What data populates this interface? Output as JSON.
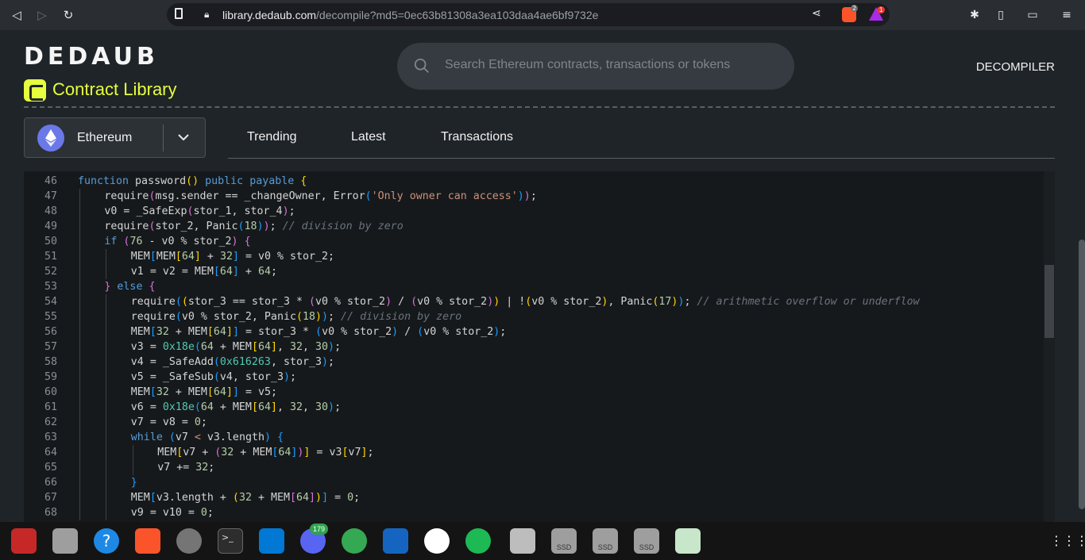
{
  "browser": {
    "url_host": "library.dedaub.com",
    "url_path": "/decompile?md5=0ec63b81308a3ea103daa4ae6bf9732e",
    "brave_badge": "2",
    "alert_badge": "1"
  },
  "header": {
    "logo": "DEDAUB",
    "library_title": "Contract Library",
    "search_placeholder": "Search Ethereum contracts, transactions or tokens",
    "nav_decompiler": "DECOMPILER"
  },
  "chain_select": {
    "selected": "Ethereum"
  },
  "tabs": [
    {
      "label": "Trending"
    },
    {
      "label": "Latest"
    },
    {
      "label": "Transactions"
    }
  ],
  "code": {
    "lines": [
      {
        "no": "46",
        "indent": 0,
        "html": "<span class=\"k\">function</span> password<span class=\"p1\">()</span> <span class=\"k\">public</span> <span class=\"k\">payable</span> <span class=\"p1\">{</span>"
      },
      {
        "no": "47",
        "indent": 1,
        "html": "require<span class=\"p2\">(</span>msg.sender == _changeOwner, Error<span class=\"p3\">(</span><span class=\"s\">'Only owner can access'</span><span class=\"p3\">)</span><span class=\"p2\">)</span>;"
      },
      {
        "no": "48",
        "indent": 1,
        "html": "v0 = _SafeExp<span class=\"p2\">(</span>stor_1, stor_4<span class=\"p2\">)</span>;"
      },
      {
        "no": "49",
        "indent": 1,
        "html": "require<span class=\"p2\">(</span>stor_2, Panic<span class=\"p3\">(</span><span class=\"n\">18</span><span class=\"p3\">)</span><span class=\"p2\">)</span>; <span class=\"c\">// division by zero</span>"
      },
      {
        "no": "50",
        "indent": 1,
        "html": "<span class=\"k\">if</span> <span class=\"p2\">(</span><span class=\"n\">76</span> - v0 % stor_2<span class=\"p2\">)</span> <span class=\"p2\">{</span>"
      },
      {
        "no": "51",
        "indent": 2,
        "html": "MEM<span class=\"p3\">[</span>MEM<span class=\"p1\">[</span><span class=\"n\">64</span><span class=\"p1\">]</span> + <span class=\"n\">32</span><span class=\"p3\">]</span> = v0 % stor_2;"
      },
      {
        "no": "52",
        "indent": 2,
        "html": "v1 = v2 = MEM<span class=\"p3\">[</span><span class=\"n\">64</span><span class=\"p3\">]</span> + <span class=\"n\">64</span>;"
      },
      {
        "no": "53",
        "indent": 1,
        "html": "<span class=\"p2\">}</span> <span class=\"k\">else</span> <span class=\"p2\">{</span>"
      },
      {
        "no": "54",
        "indent": 2,
        "html": "require<span class=\"p3\">(</span><span class=\"p1\">(</span>stor_3 == stor_3 * <span class=\"p2\">(</span>v0 % stor_2<span class=\"p2\">)</span> / <span class=\"p2\">(</span>v0 % stor_2<span class=\"p2\">)</span><span class=\"p1\">)</span> | !<span class=\"p1\">(</span>v0 % stor_2<span class=\"p1\">)</span>, Panic<span class=\"p1\">(</span><span class=\"n\">17</span><span class=\"p1\">)</span><span class=\"p3\">)</span>; <span class=\"c\">// arithmetic overflow or underflow</span>"
      },
      {
        "no": "55",
        "indent": 2,
        "html": "require<span class=\"p3\">(</span>v0 % stor_2, Panic<span class=\"p1\">(</span><span class=\"n\">18</span><span class=\"p1\">)</span><span class=\"p3\">)</span>; <span class=\"c\">// division by zero</span>"
      },
      {
        "no": "56",
        "indent": 2,
        "html": "MEM<span class=\"p3\">[</span><span class=\"n\">32</span> + MEM<span class=\"p1\">[</span><span class=\"n\">64</span><span class=\"p1\">]</span><span class=\"p3\">]</span> = stor_3 * <span class=\"p3\">(</span>v0 % stor_2<span class=\"p3\">)</span> / <span class=\"p3\">(</span>v0 % stor_2<span class=\"p3\">)</span>;"
      },
      {
        "no": "57",
        "indent": 2,
        "html": "v3 = <span class=\"h\">0x18e</span><span class=\"p3\">(</span><span class=\"n\">64</span> + MEM<span class=\"p1\">[</span><span class=\"n\">64</span><span class=\"p1\">]</span>, <span class=\"n\">32</span>, <span class=\"n\">30</span><span class=\"p3\">)</span>;"
      },
      {
        "no": "58",
        "indent": 2,
        "html": "v4 = _SafeAdd<span class=\"p3\">(</span><span class=\"h\">0x616263</span>, stor_3<span class=\"p3\">)</span>;"
      },
      {
        "no": "59",
        "indent": 2,
        "html": "v5 = _SafeSub<span class=\"p3\">(</span>v4, stor_3<span class=\"p3\">)</span>;"
      },
      {
        "no": "60",
        "indent": 2,
        "html": "MEM<span class=\"p3\">[</span><span class=\"n\">32</span> + MEM<span class=\"p1\">[</span><span class=\"n\">64</span><span class=\"p1\">]</span><span class=\"p3\">]</span> = v5;"
      },
      {
        "no": "61",
        "indent": 2,
        "html": "v6 = <span class=\"h\">0x18e</span><span class=\"p3\">(</span><span class=\"n\">64</span> + MEM<span class=\"p1\">[</span><span class=\"n\">64</span><span class=\"p1\">]</span>, <span class=\"n\">32</span>, <span class=\"n\">30</span><span class=\"p3\">)</span>;"
      },
      {
        "no": "62",
        "indent": 2,
        "html": "v7 = v8 = <span class=\"n\">0</span>;"
      },
      {
        "no": "63",
        "indent": 2,
        "html": "<span class=\"k\">while</span> <span class=\"p3\">(</span>v7 <span class=\"s\">&lt;</span> v3.length<span class=\"p3\">)</span> <span class=\"p3\">{</span>"
      },
      {
        "no": "64",
        "indent": 3,
        "html": "MEM<span class=\"p1\">[</span>v7 + <span class=\"p2\">(</span><span class=\"n\">32</span> + MEM<span class=\"p3\">[</span><span class=\"n\">64</span><span class=\"p3\">]</span><span class=\"p2\">)</span><span class=\"p1\">]</span> = v3<span class=\"p1\">[</span>v7<span class=\"p1\">]</span>;"
      },
      {
        "no": "65",
        "indent": 3,
        "html": "v7 += <span class=\"n\">32</span>;"
      },
      {
        "no": "66",
        "indent": 2,
        "html": "<span class=\"p3\">}</span>"
      },
      {
        "no": "67",
        "indent": 2,
        "html": "MEM<span class=\"p3\">[</span>v3.length + <span class=\"p1\">(</span><span class=\"n\">32</span> + MEM<span class=\"p2\">[</span><span class=\"n\">64</span><span class=\"p2\">]</span><span class=\"p1\">)</span><span class=\"p3\">]</span> = <span class=\"n\">0</span>;"
      },
      {
        "no": "68",
        "indent": 2,
        "html": "v9 = v10 = <span class=\"n\">0</span>;"
      }
    ]
  },
  "taskbar": {
    "discord_badge": "179",
    "ssd_label": "SSD"
  },
  "colors": {
    "accent": "#e6ff3d",
    "eth": "#6b78e8"
  }
}
